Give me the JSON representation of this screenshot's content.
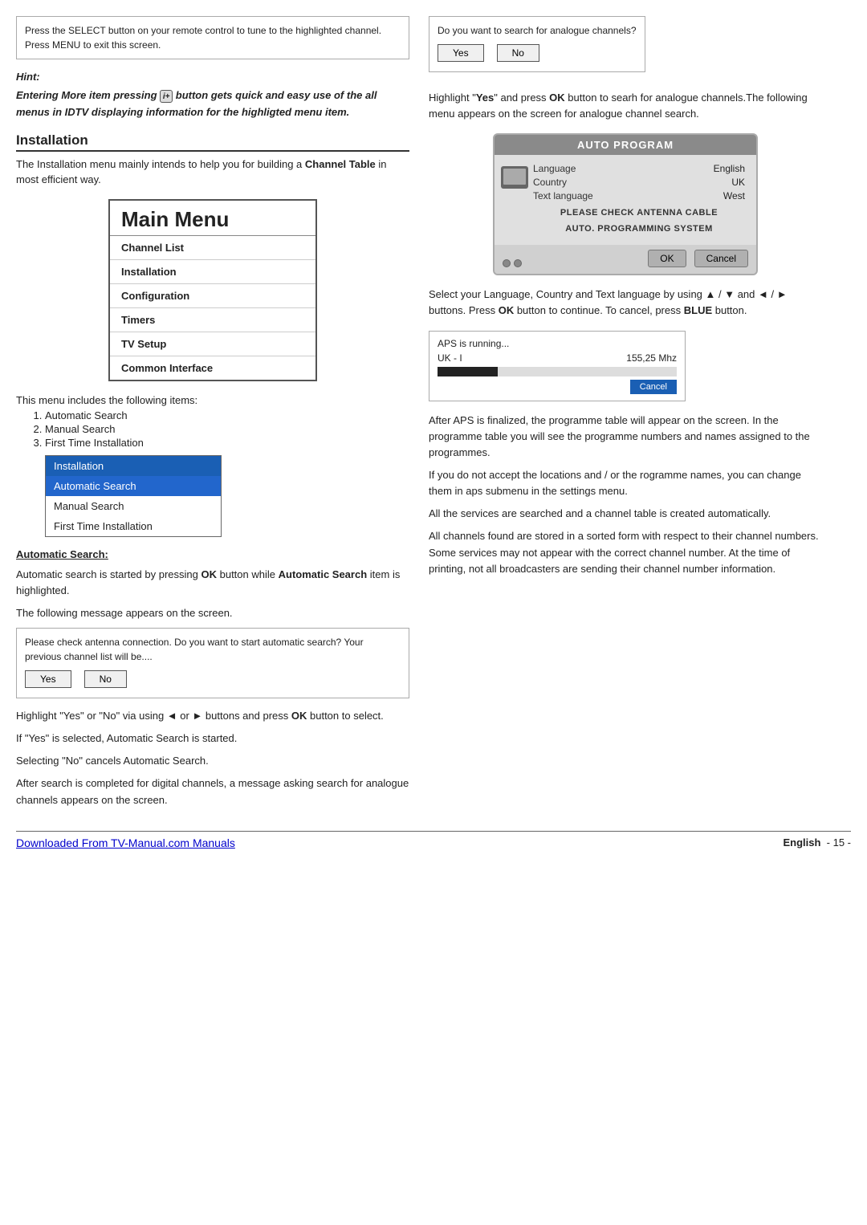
{
  "hintBox": {
    "line1": "Press the SELECT button on your remote control to tune to the highlighted channel.",
    "line2": "Press MENU to exit this screen."
  },
  "hint": {
    "label": "Hint:",
    "text": "Entering More item pressing   button gets quick  and easy use of the all menus in IDTV displaying information for the highligted menu item."
  },
  "installation": {
    "title": "Installation",
    "desc": "The Installation menu mainly intends to help you for building a Channel Table in most efficient way."
  },
  "mainMenu": {
    "title": "Main Menu",
    "items": [
      {
        "label": "Channel List",
        "bold": true
      },
      {
        "label": "Installation",
        "bold": true
      },
      {
        "label": "Configuration",
        "bold": true
      },
      {
        "label": "Timers",
        "bold": true
      },
      {
        "label": "TV Setup",
        "bold": true
      },
      {
        "label": "Common Interface",
        "bold": true
      }
    ]
  },
  "followingItems": {
    "intro": "This menu includes the following items:",
    "list": [
      "Automatic Search",
      "Manual Search",
      "First Time Installation"
    ]
  },
  "submenu": {
    "items": [
      {
        "label": "Installation",
        "style": "highlighted"
      },
      {
        "label": "Automatic Search",
        "style": "active"
      },
      {
        "label": "Manual Search",
        "style": "normal"
      },
      {
        "label": "First Time Installation",
        "style": "normal"
      }
    ]
  },
  "autoSearch": {
    "title": "Automatic Search:",
    "para1": "Automatic search is started by pressing OK button while Automatic Search item is highlighted.",
    "para2": "The following message appears on the screen."
  },
  "dialogLeft": {
    "text": "Please check antenna connection. Do you want to start automatic search? Your previous channel list will be....",
    "yesLabel": "Yes",
    "noLabel": "No"
  },
  "leftBodyTexts": [
    "Highlight \"Yes\" or \"No\" via using  ◄  or  ►  buttons and press OK button to select.",
    "If \"Yes\" is selected, Automatic Search is started.",
    "Selecting \"No\" cancels Automatic Search.",
    "After search is completed for digital channels, a message asking search for analogue channels appears on the screen."
  ],
  "rightTop": {
    "dialogText1": "Do you want to search for analogue channels?",
    "yesLabel": "Yes",
    "noLabel": "No",
    "desc": "Highlight \"Yes\" and press OK button to searh for analogue channels.The following menu appears on the screen for analogue channel search."
  },
  "autoProgram": {
    "header": "AUTO PROGRAM",
    "languageLabel": "Language",
    "languageValue": "English",
    "countryLabel": "Country",
    "countryValue": "UK",
    "textLangLabel": "Text language",
    "textLangValue": "West",
    "notice1": "PLEASE CHECK ANTENNA CABLE",
    "notice2": "AUTO. PROGRAMMING SYSTEM",
    "okLabel": "OK",
    "cancelLabel": "Cancel"
  },
  "rightMidText": "Select your Language, Country and Text language by using ▲ / ▼ and ◄ / ► buttons. Press OK button to continue. To cancel, press BLUE button.",
  "apsBox": {
    "running": "APS is running...",
    "channel": "UK - I",
    "freq": "155,25  Mhz",
    "cancelLabel": "Cancel"
  },
  "rightBodyTexts": [
    "After APS is finalized, the programme table will appear on the screen. In the programme table you will see the programme numbers and names assigned to the programmes.",
    "If you do not accept the locations and / or the rogramme names, you can change them in aps submenu in the settings menu.",
    "All the services are searched and a channel table is created automatically.",
    "All channels found are stored in a sorted form with respect to their channel numbers.  Some services may not appear with the correct channel number.  At the time of printing, not all broadcasters are sending their channel number information."
  ],
  "footer": {
    "linkText": "Downloaded From TV-Manual.com Manuals",
    "langLabel": "English",
    "pageText": "- 15 -"
  }
}
